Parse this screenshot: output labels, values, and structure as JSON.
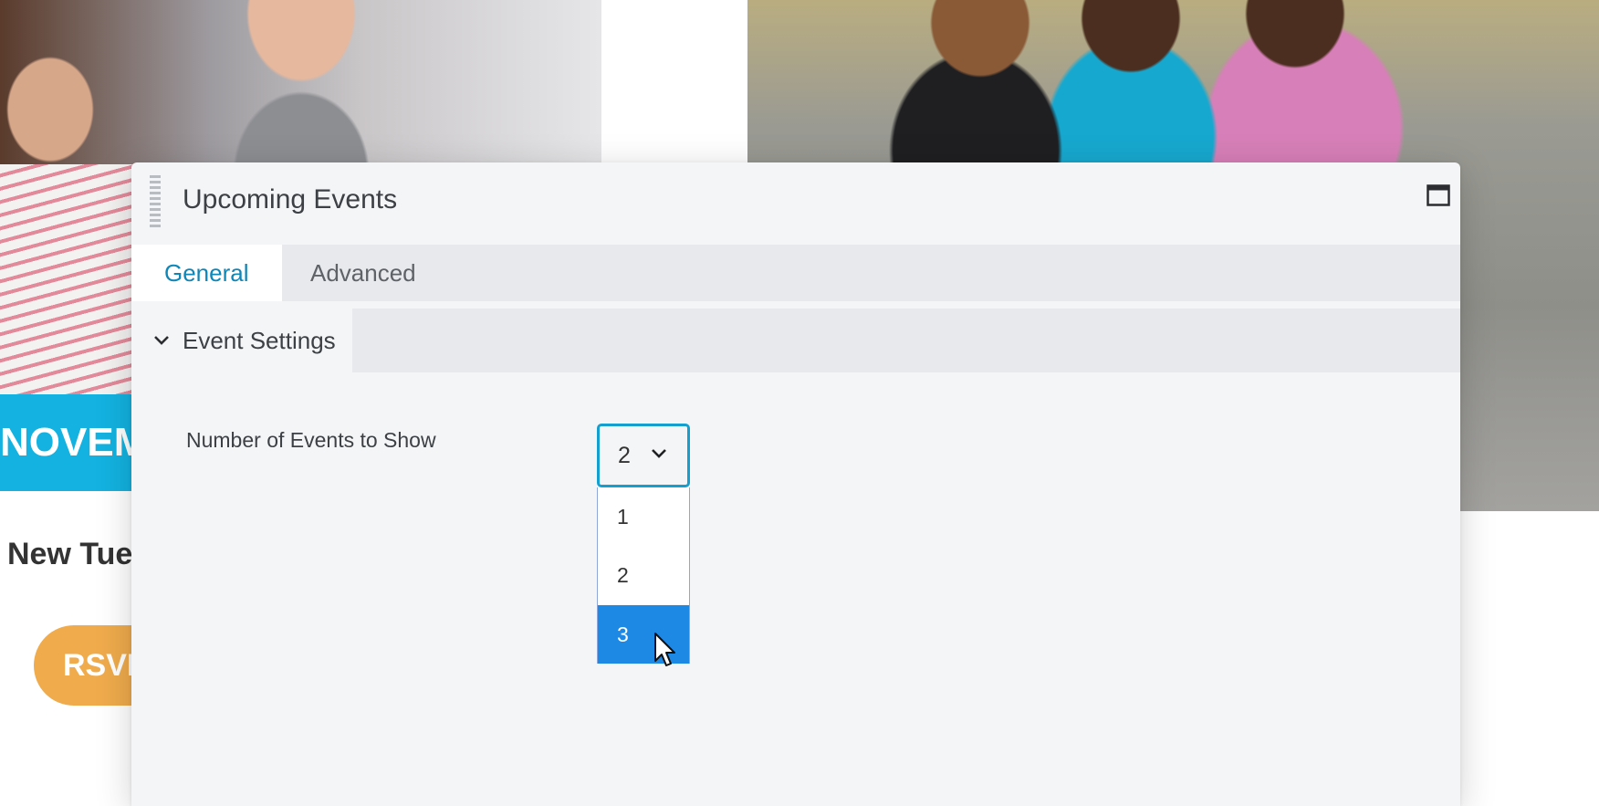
{
  "background": {
    "banner_text": "NOVEM",
    "event_title": "New Tue",
    "rsvp_label": "RSVP"
  },
  "panel": {
    "title": "Upcoming Events",
    "tabs": [
      {
        "label": "General",
        "active": true
      },
      {
        "label": "Advanced",
        "active": false
      }
    ],
    "section": {
      "label": "Event Settings",
      "expanded": true
    },
    "field": {
      "label": "Number of Events to Show",
      "selected_value": "2",
      "options": [
        "1",
        "2",
        "3"
      ],
      "highlighted_option": "3"
    }
  },
  "colors": {
    "accent": "#159fce",
    "tab_active_text": "#0f86b8",
    "option_highlight": "#1e88e5",
    "banner": "#13b2e0",
    "rsvp": "#efab4c"
  }
}
